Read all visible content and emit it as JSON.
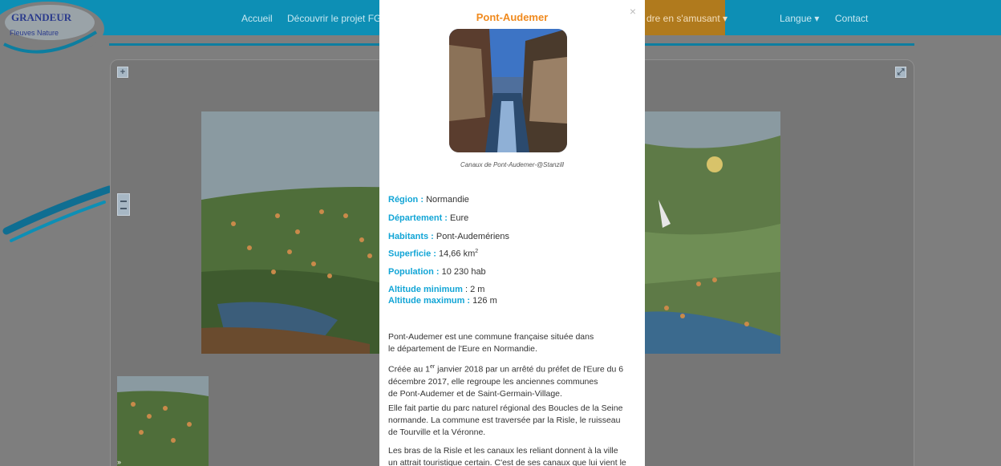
{
  "nav": {
    "logo_line1": "GRANDEUR",
    "logo_line2": "Fleuves Nature",
    "items": [
      "Accueil",
      "Découvrir le projet FGN",
      "dre en s'amusant ▾",
      "Langue ▾",
      "Contact"
    ]
  },
  "map": {
    "zoom_in": "+",
    "fullscreen": "⤢",
    "minimap_toggle": "»"
  },
  "modal": {
    "close": "×",
    "title": "Pont-Audemer",
    "caption": "Canaux de Pont-Audemer-@Stanzill",
    "fields": {
      "region_label": "Région",
      "region_value": "Normandie",
      "departement_label": "Département",
      "departement_value": "Eure",
      "habitants_label": "Habitants",
      "habitants_value": "Pont-Audemériens",
      "superficie_label": "Superficie",
      "superficie_value": "14,66 km",
      "superficie_sup": "2",
      "population_label": "Population",
      "population_value": "10 230 hab",
      "alt_min_label": "Altitude minimum",
      "alt_min_value": "2 m",
      "alt_max_label": "Altitude maximum",
      "alt_max_value": "126 m"
    },
    "paragraphs": {
      "p1_line1": "Pont-Audemer est une commune française située dans",
      "p1_line2": "le département de l'Eure en Normandie.",
      "p2_pre": "Créée au 1",
      "p2_sup": "er",
      "p2_line1_rest": " janvier 2018 par un arrêté du préfet de l'Eure du 6",
      "p2_line2": "décembre 2017, elle regroupe les anciennes communes",
      "p2_line3": "de Pont-Audemer et de Saint-Germain-Village.",
      "p3_line1": "Elle fait partie du parc naturel régional des Boucles de la Seine",
      "p3_line2": "normande. La commune est traversée par la Risle, le ruisseau",
      "p3_line3": "de Tourville et la Véronne.",
      "p4_line1": "Les bras de la Risle et les canaux les reliant donnent à la ville",
      "p4_line2": "un attrait touristique certain. C'est de ses canaux que lui vient le"
    }
  },
  "colors": {
    "nav_bg": "#0d8fb5",
    "accent_orange": "#f08a1e",
    "label_blue": "#12a5d6",
    "overlay": "#7e7e7e"
  }
}
